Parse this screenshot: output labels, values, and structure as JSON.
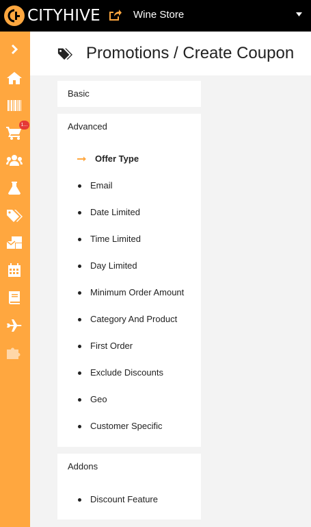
{
  "brand": {
    "name": "CITYHIVE",
    "accent": "#ffa73f"
  },
  "store": {
    "name": "Wine Store",
    "icon": "share-icon"
  },
  "sidebar": {
    "items": [
      {
        "name": "expand",
        "icon": "chevron-right-icon"
      },
      {
        "name": "home",
        "icon": "home-icon"
      },
      {
        "name": "products",
        "icon": "barcode-icon"
      },
      {
        "name": "orders",
        "icon": "cart-icon",
        "badge": "1..."
      },
      {
        "name": "customers",
        "icon": "users-icon"
      },
      {
        "name": "labs",
        "icon": "flask-icon"
      },
      {
        "name": "promotions",
        "icon": "tags-icon"
      },
      {
        "name": "marketing",
        "icon": "mail-bulk-icon"
      },
      {
        "name": "calendar",
        "icon": "calendar-icon"
      },
      {
        "name": "content",
        "icon": "book-icon"
      },
      {
        "name": "delivery",
        "icon": "plane-icon"
      },
      {
        "name": "integrations",
        "icon": "puzzle-icon"
      }
    ]
  },
  "header": {
    "title": "Promotions / Create Coupon",
    "icon": "tags-icon"
  },
  "sections": {
    "basic": {
      "title": "Basic"
    },
    "advanced": {
      "title": "Advanced",
      "active_item": "Offer Type",
      "items": [
        "Email",
        "Date Limited",
        "Time Limited",
        "Day Limited",
        "Minimum Order Amount",
        "Category And Product",
        "First Order",
        "Exclude Discounts",
        "Geo",
        "Customer Specific"
      ]
    },
    "addons": {
      "title": "Addons",
      "items": [
        "Discount Feature"
      ]
    }
  }
}
